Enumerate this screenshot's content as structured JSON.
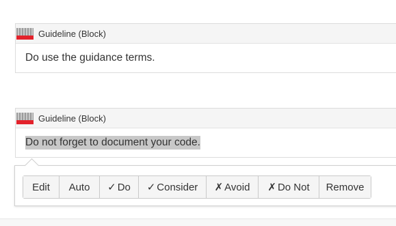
{
  "blocks": [
    {
      "title": "Guideline (Block)",
      "text": "Do use the guidance terms."
    },
    {
      "title": "Guideline (Block)",
      "text": "Do not forget to document your code."
    }
  ],
  "toolbar": {
    "buttons": [
      {
        "mark": "",
        "label": "Edit"
      },
      {
        "mark": "",
        "label": "Auto"
      },
      {
        "mark": "✓",
        "label": "Do"
      },
      {
        "mark": "✓",
        "label": "Consider"
      },
      {
        "mark": "✗",
        "label": "Avoid"
      },
      {
        "mark": "✗",
        "label": "Do Not"
      },
      {
        "mark": "",
        "label": "Remove"
      }
    ]
  },
  "colors": {
    "icon_red": "#e3222b",
    "selection": "#c8c8c8"
  },
  "icons": [
    "guideline-block-icon"
  ]
}
